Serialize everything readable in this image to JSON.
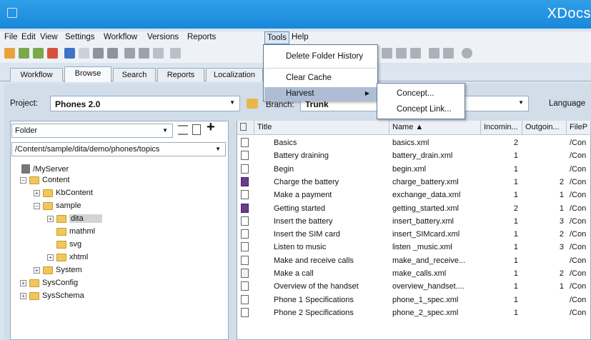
{
  "window": {
    "title": "XDocs"
  },
  "menubar": {
    "items": [
      "File",
      "Edit",
      "View",
      "Settings",
      "Workflow",
      "Versions",
      "Reports",
      "Tools",
      "Help"
    ]
  },
  "tabs": [
    "Workflow",
    "Browse",
    "Search",
    "Reports",
    "Localization"
  ],
  "toolbar_icons": [
    "new-doc-icon",
    "checkin-icon",
    "checkout-icon",
    "delete-icon",
    "link-icon",
    "document-icon",
    "building-icon",
    "building-alt-icon",
    "stack-icon",
    "stack-alt-icon",
    "merge-icon",
    "page-icon",
    "arrow-right-icon",
    "arrow-left-icon",
    "page-back-icon",
    "grid-icon",
    "pencil-arrow-icon",
    "refresh-icon"
  ],
  "project": {
    "label": "Project:",
    "value": "Phones 2.0"
  },
  "branch": {
    "label": "Branch:",
    "value": "Trunk"
  },
  "language": {
    "label": "Language"
  },
  "left_panel": {
    "folder_select": "Folder",
    "path": "/Content/sample/dita/demo/phones/topics",
    "tree": [
      "/MyServer",
      "Content",
      "KbContent",
      "sample",
      "dita",
      "mathml",
      "svg",
      "xhtml",
      "System",
      "SysConfig",
      "SysSchema"
    ]
  },
  "table": {
    "columns": [
      "Title",
      "Name ▲",
      "Incomin...",
      "Outgoin...",
      "FileP"
    ],
    "rows": [
      {
        "title": "Basics",
        "name": "basics.xml",
        "incoming": "2",
        "outgoing": "",
        "path": "/Con"
      },
      {
        "title": "Battery draining",
        "name": "battery_drain.xml",
        "incoming": "1",
        "outgoing": "",
        "path": "/Con"
      },
      {
        "title": "Begin",
        "name": "begin.xml",
        "incoming": "1",
        "outgoing": "",
        "path": "/Con"
      },
      {
        "title": "Charge the battery",
        "name": "charge_battery.xml",
        "incoming": "1",
        "outgoing": "2",
        "path": "/Con"
      },
      {
        "title": "Make a payment",
        "name": "exchange_data.xml",
        "incoming": "1",
        "outgoing": "1",
        "path": "/Con"
      },
      {
        "title": "Getting started",
        "name": "getting_started.xml",
        "incoming": "2",
        "outgoing": "1",
        "path": "/Con"
      },
      {
        "title": "Insert the battery",
        "name": "insert_battery.xml",
        "incoming": "1",
        "outgoing": "3",
        "path": "/Con"
      },
      {
        "title": "Insert the SIM card",
        "name": "insert_SIMcard.xml",
        "incoming": "1",
        "outgoing": "2",
        "path": "/Con"
      },
      {
        "title": "Listen to music",
        "name": "listen _music.xml",
        "incoming": "1",
        "outgoing": "3",
        "path": "/Con"
      },
      {
        "title": "Make and receive calls",
        "name": "make_and_receive...",
        "incoming": "1",
        "outgoing": "",
        "path": "/Con"
      },
      {
        "title": "Make a call",
        "name": "make_calls.xml",
        "incoming": "1",
        "outgoing": "2",
        "path": "/Con"
      },
      {
        "title": "Overview of the handset",
        "name": "overview_handset....",
        "incoming": "1",
        "outgoing": "1",
        "path": "/Con"
      },
      {
        "title": "Phone 1 Specifications",
        "name": "phone_1_spec.xml",
        "incoming": "1",
        "outgoing": "",
        "path": "/Con"
      },
      {
        "title": "Phone 2 Specifications",
        "name": "phone_2_spec.xml",
        "incoming": "1",
        "outgoing": "",
        "path": "/Con"
      }
    ]
  },
  "tools_menu": {
    "items": [
      "Delete Folder History",
      "Clear Cache",
      "Harvest"
    ],
    "harvest_submenu": [
      "Concept...",
      "Concept Link..."
    ]
  }
}
